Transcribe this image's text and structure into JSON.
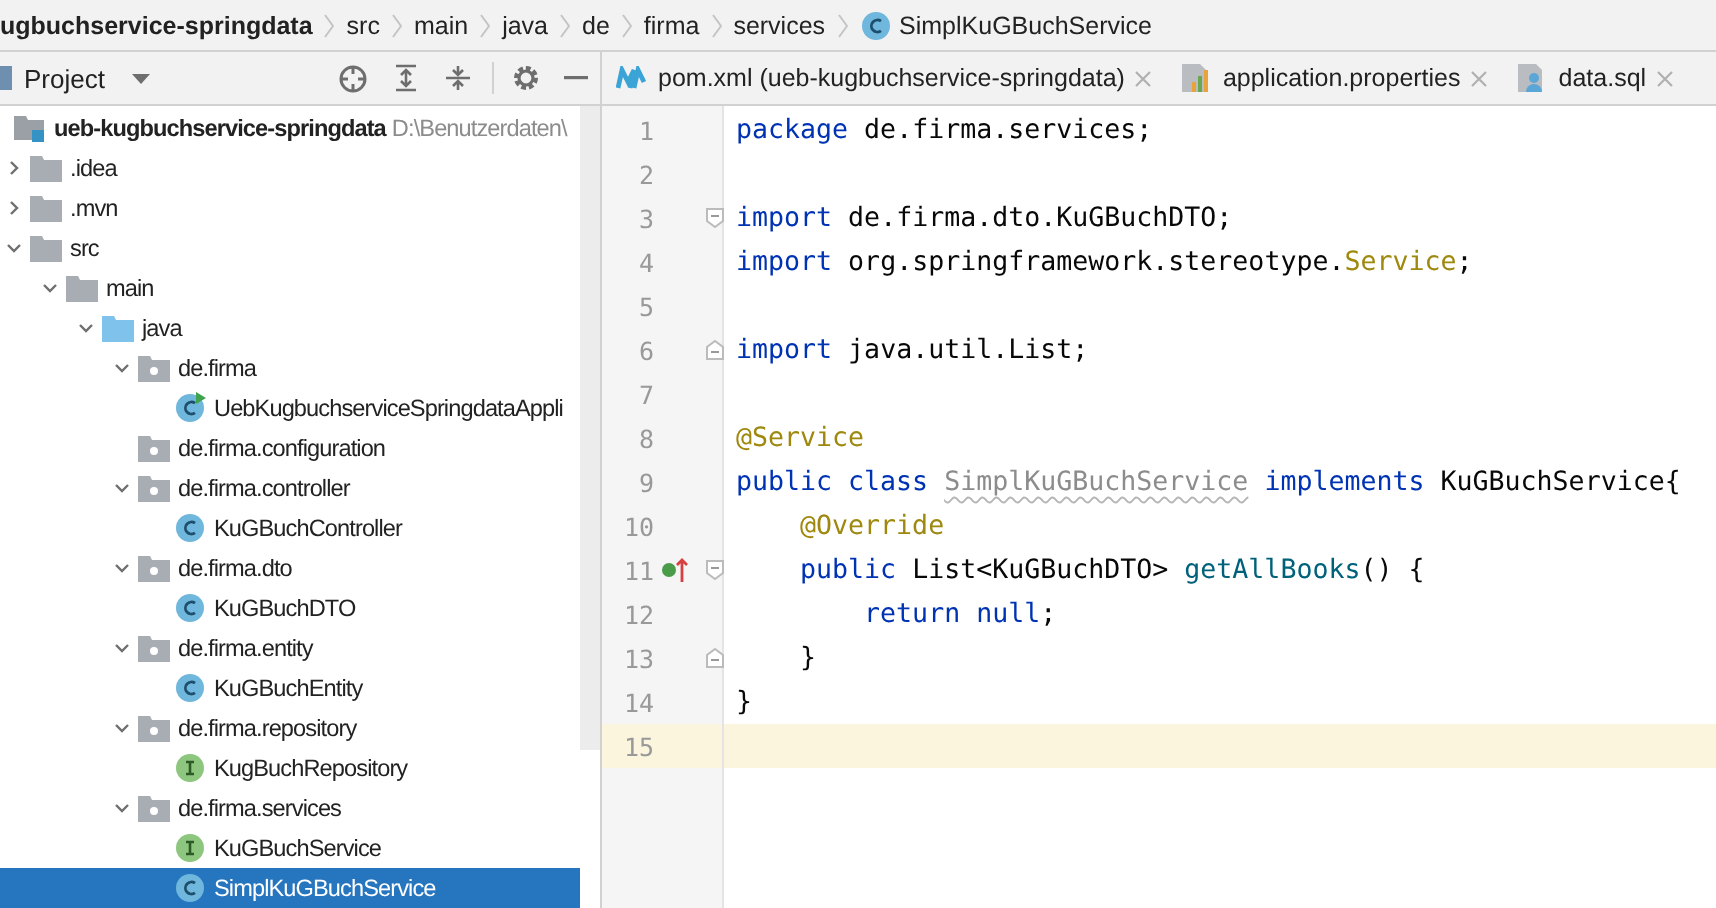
{
  "breadcrumb": [
    {
      "label": "ugbuchservice-springdata",
      "kind": "project"
    },
    {
      "label": "src",
      "kind": "dir"
    },
    {
      "label": "main",
      "kind": "dir"
    },
    {
      "label": "java",
      "kind": "dir"
    },
    {
      "label": "de",
      "kind": "dir"
    },
    {
      "label": "firma",
      "kind": "dir"
    },
    {
      "label": "services",
      "kind": "dir"
    },
    {
      "label": "SimplKuGBuchService",
      "kind": "class"
    }
  ],
  "project_panel": {
    "title": "Project"
  },
  "tree": [
    {
      "label": "ueb-kugbuchservice-springdata",
      "hint": "D:\\Benutzerdaten\\",
      "kind": "module",
      "selected": false,
      "children": [
        {
          "label": ".idea",
          "kind": "folder",
          "expanded": false,
          "selected": false
        },
        {
          "label": ".mvn",
          "kind": "folder",
          "expanded": false,
          "selected": false
        },
        {
          "label": "src",
          "kind": "folder",
          "expanded": true,
          "selected": false,
          "children": [
            {
              "label": "main",
              "kind": "folder",
              "expanded": true,
              "selected": false,
              "children": [
                {
                  "label": "java",
                  "kind": "source",
                  "expanded": true,
                  "selected": false,
                  "children": [
                    {
                      "label": "de.firma",
                      "kind": "package",
                      "expanded": true,
                      "selected": false,
                      "children": [
                        {
                          "label": "UebKugbuchserviceSpringdataAppli",
                          "kind": "app",
                          "selected": false
                        }
                      ]
                    },
                    {
                      "label": "de.firma.configuration",
                      "kind": "package",
                      "selected": false
                    },
                    {
                      "label": "de.firma.controller",
                      "kind": "package",
                      "expanded": true,
                      "selected": false,
                      "children": [
                        {
                          "label": "KuGBuchController",
                          "kind": "class",
                          "selected": false
                        }
                      ]
                    },
                    {
                      "label": "de.firma.dto",
                      "kind": "package",
                      "expanded": true,
                      "selected": false,
                      "children": [
                        {
                          "label": "KuGBuchDTO",
                          "kind": "class",
                          "selected": false
                        }
                      ]
                    },
                    {
                      "label": "de.firma.entity",
                      "kind": "package",
                      "expanded": true,
                      "selected": false,
                      "children": [
                        {
                          "label": "KuGBuchEntity",
                          "kind": "class",
                          "selected": false
                        }
                      ]
                    },
                    {
                      "label": "de.firma.repository",
                      "kind": "package",
                      "expanded": true,
                      "selected": false,
                      "children": [
                        {
                          "label": "KugBuchRepository",
                          "kind": "interface",
                          "selected": false
                        }
                      ]
                    },
                    {
                      "label": "de.firma.services",
                      "kind": "package",
                      "expanded": true,
                      "selected": false,
                      "children": [
                        {
                          "label": "KuGBuchService",
                          "kind": "interface",
                          "selected": false
                        },
                        {
                          "label": "SimplKuGBuchService",
                          "kind": "class",
                          "selected": true
                        }
                      ]
                    }
                  ]
                }
              ]
            }
          ]
        }
      ]
    }
  ],
  "editor_tabs": [
    {
      "label": "pom.xml (ueb-kugbuchservice-springdata)",
      "kind": "maven",
      "selected": false
    },
    {
      "label": "application.properties",
      "kind": "properties",
      "selected": false
    },
    {
      "label": "data.sql",
      "kind": "sql",
      "selected": false
    }
  ],
  "code_lines": [
    {
      "number": "1",
      "current": false,
      "tokens": [
        {
          "text": "package",
          "kind": "kw"
        },
        {
          "text": " de.firma.services;",
          "kind": "plain"
        }
      ]
    },
    {
      "number": "2",
      "current": false
    },
    {
      "number": "3",
      "current": false,
      "gutter": [
        {
          "kind": "fold-start"
        }
      ],
      "tokens": [
        {
          "text": "import",
          "kind": "kw"
        },
        {
          "text": " de.firma.dto.KuGBuchDTO;",
          "kind": "plain"
        }
      ]
    },
    {
      "number": "4",
      "current": false,
      "tokens": [
        {
          "text": "import",
          "kind": "kw"
        },
        {
          "text": " org.springframework.stereotype.",
          "kind": "plain"
        },
        {
          "text": "Service",
          "kind": "annotation"
        },
        {
          "text": ";",
          "kind": "plain"
        }
      ]
    },
    {
      "number": "5",
      "current": false
    },
    {
      "number": "6",
      "current": false,
      "gutter": [
        {
          "kind": "fold-end"
        }
      ],
      "tokens": [
        {
          "text": "import",
          "kind": "kw"
        },
        {
          "text": " java.util.List;",
          "kind": "plain"
        }
      ]
    },
    {
      "number": "7",
      "current": false
    },
    {
      "number": "8",
      "current": false,
      "tokens": [
        {
          "text": "@Service",
          "kind": "annotation"
        }
      ]
    },
    {
      "number": "9",
      "current": false,
      "tokens": [
        {
          "text": "public class ",
          "kind": "kw"
        },
        {
          "text": "SimplKuGBuchService",
          "kind": "unused"
        },
        {
          "text": " implements ",
          "kind": "kw"
        },
        {
          "text": "KuGBuchService{",
          "kind": "plain"
        }
      ]
    },
    {
      "number": "10",
      "current": false,
      "tokens": [
        {
          "text": "    @Override",
          "kind": "annotation"
        }
      ]
    },
    {
      "number": "11",
      "current": false,
      "gutter": [
        {
          "kind": "implements"
        },
        {
          "kind": "fold-start"
        }
      ],
      "tokens": [
        {
          "text": "    public ",
          "kind": "kw"
        },
        {
          "text": "List<KuGBuchDTO> ",
          "kind": "plain"
        },
        {
          "text": "getAllBooks",
          "kind": "method"
        },
        {
          "text": "() {",
          "kind": "plain"
        }
      ]
    },
    {
      "number": "12",
      "current": false,
      "tokens": [
        {
          "text": "        return null",
          "kind": "kw"
        },
        {
          "text": ";",
          "kind": "plain"
        }
      ]
    },
    {
      "number": "13",
      "current": false,
      "gutter": [
        {
          "kind": "fold-end"
        }
      ],
      "tokens": [
        {
          "text": "    }",
          "kind": "plain"
        }
      ]
    },
    {
      "number": "14",
      "current": false,
      "tokens": [
        {
          "text": "}",
          "kind": "plain"
        }
      ]
    },
    {
      "number": "15",
      "current": true
    }
  ]
}
